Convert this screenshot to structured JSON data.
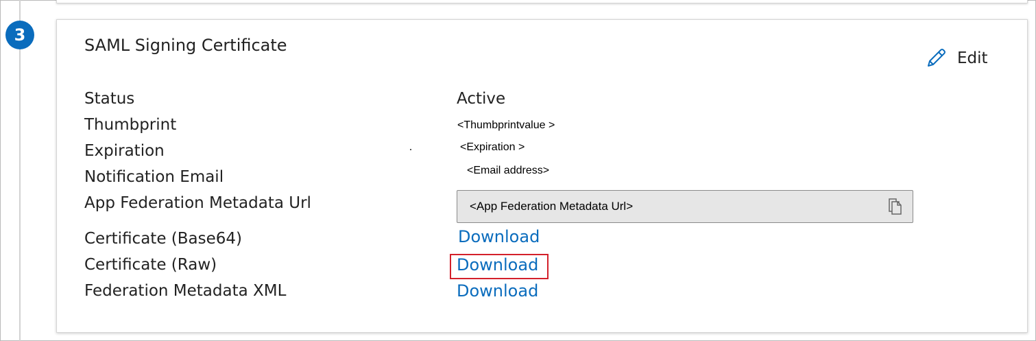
{
  "step": {
    "number": "3"
  },
  "section": {
    "title": "SAML Signing Certificate",
    "edit_label": "Edit"
  },
  "rows": {
    "status": {
      "label": "Status",
      "value": "Active"
    },
    "thumbprint": {
      "label": "Thumbprint",
      "value": "<Thumbprintvalue >"
    },
    "expiration": {
      "label": "Expiration",
      "value": "<Expiration >"
    },
    "notification_email": {
      "label": "Notification Email",
      "value": "<Email address>"
    },
    "metadata_url": {
      "label": "App Federation Metadata Url",
      "value": "<App Federation  Metadata Url>"
    },
    "cert_base64": {
      "label": "Certificate (Base64)",
      "link": "Download"
    },
    "cert_raw": {
      "label": "Certificate (Raw)",
      "link": "Download"
    },
    "fed_xml": {
      "label": "Federation Metadata XML",
      "link": "Download"
    }
  },
  "icons": {
    "edit": "pencil-icon",
    "copy": "copy-icon"
  },
  "colors": {
    "accent": "#0a6cbd",
    "highlight": "#d3202a",
    "field_bg": "#e6e6e6"
  }
}
